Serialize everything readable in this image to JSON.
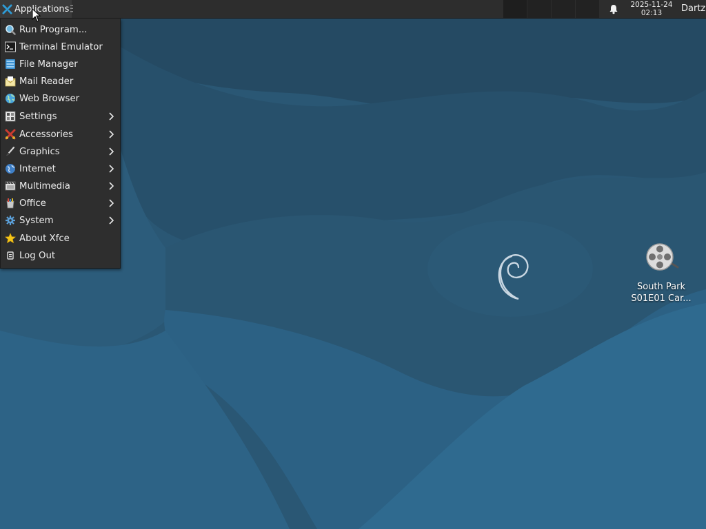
{
  "panel": {
    "applications_label": "Applications",
    "clock_date": "2025-11-24",
    "clock_time": "02:13",
    "user": "Dartz",
    "workspace_count": 4
  },
  "menu": {
    "items": [
      {
        "label": "Run Program...",
        "icon": "run-program-icon",
        "submenu": false
      },
      {
        "label": "Terminal Emulator",
        "icon": "terminal-icon",
        "submenu": false
      },
      {
        "label": "File Manager",
        "icon": "file-manager-icon",
        "submenu": false
      },
      {
        "label": "Mail Reader",
        "icon": "mail-icon",
        "submenu": false
      },
      {
        "label": "Web Browser",
        "icon": "web-browser-icon",
        "submenu": false
      },
      {
        "label": "Settings",
        "icon": "settings-icon",
        "submenu": true
      },
      {
        "label": "Accessories",
        "icon": "accessories-icon",
        "submenu": true
      },
      {
        "label": "Graphics",
        "icon": "graphics-icon",
        "submenu": true
      },
      {
        "label": "Internet",
        "icon": "internet-icon",
        "submenu": true
      },
      {
        "label": "Multimedia",
        "icon": "multimedia-icon",
        "submenu": true
      },
      {
        "label": "Office",
        "icon": "office-icon",
        "submenu": true
      },
      {
        "label": "System",
        "icon": "system-icon",
        "submenu": true
      },
      {
        "label": "About Xfce",
        "icon": "star-icon",
        "submenu": false
      },
      {
        "label": "Log Out",
        "icon": "log-out-icon",
        "submenu": false
      }
    ]
  },
  "desktop": {
    "icon_label_line1": "South Park",
    "icon_label_line2": "S01E01 Car...",
    "icon": "video-file-icon"
  },
  "colors": {
    "panel_bg": "#2d2d2d",
    "menu_bg": "#2e2e2e",
    "wallpaper_base": "#2b5a78",
    "xfce_blue": "#2e9bd6"
  }
}
